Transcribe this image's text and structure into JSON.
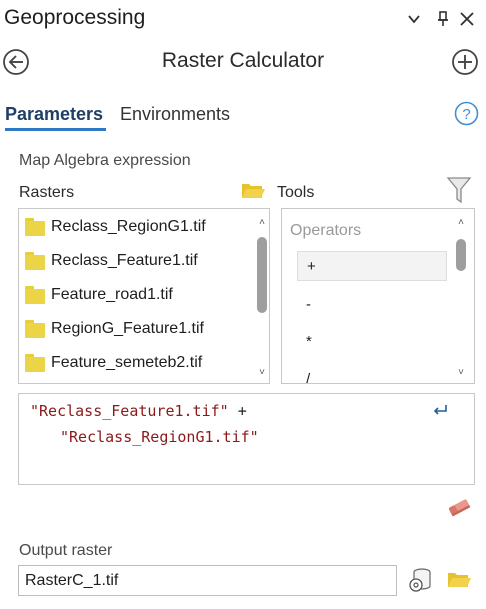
{
  "pane": {
    "title": "Geoprocessing",
    "buttons": [
      "chevron-down-icon",
      "pin-icon",
      "close-icon"
    ]
  },
  "tool": {
    "title": "Raster Calculator"
  },
  "tabs": {
    "parameters": "Parameters",
    "environments": "Environments"
  },
  "section": {
    "map_algebra_label": "Map Algebra expression",
    "rasters_label": "Rasters",
    "tools_label": "Tools"
  },
  "rasters": [
    "Reclass_RegionG1.tif",
    "Reclass_Feature1.tif",
    "Feature_road1.tif",
    "RegionG_Feature1.tif",
    "Feature_semeteb2.tif"
  ],
  "tools_list": {
    "header": "Operators",
    "operators": [
      "+",
      "-",
      "*",
      "/"
    ],
    "selected": "+"
  },
  "expression": {
    "line1_str": "\"Reclass_Feature1.tif\"",
    "line1_op": " +",
    "line2_str": "\"Reclass_RegionG1.tif\""
  },
  "output": {
    "label": "Output raster",
    "value": "RasterC_1.tif"
  },
  "colors": {
    "accent": "#2f78c4",
    "folder": "#ecd447",
    "expression_string": "#8b1a1a"
  }
}
